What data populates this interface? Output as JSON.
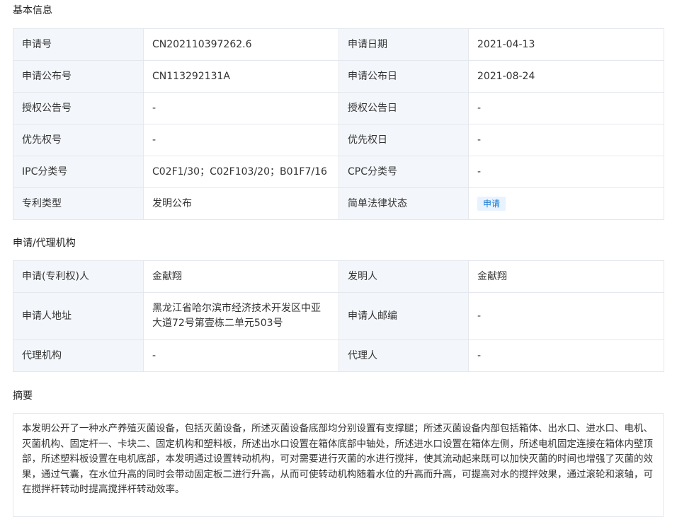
{
  "sections": {
    "basic": "基本信息",
    "agency": "申请/代理机构",
    "abstract": "摘要"
  },
  "basic_info": {
    "app_no_label": "申请号",
    "app_no": "CN202110397262.6",
    "app_date_label": "申请日期",
    "app_date": "2021-04-13",
    "pub_no_label": "申请公布号",
    "pub_no": "CN113292131A",
    "pub_date_label": "申请公布日",
    "pub_date": "2021-08-24",
    "grant_no_label": "授权公告号",
    "grant_no": "-",
    "grant_date_label": "授权公告日",
    "grant_date": "-",
    "priority_no_label": "优先权号",
    "priority_no": "-",
    "priority_date_label": "优先权日",
    "priority_date": "-",
    "ipc_label": "IPC分类号",
    "ipc": "C02F1/30；C02F103/20；B01F7/16",
    "cpc_label": "CPC分类号",
    "cpc": "-",
    "type_label": "专利类型",
    "type": "发明公布",
    "legal_status_label": "简单法律状态",
    "legal_status": "申请"
  },
  "agency_info": {
    "applicant_label": "申请(专利权)人",
    "applicant": "金献翔",
    "inventor_label": "发明人",
    "inventor": "金献翔",
    "address_label": "申请人地址",
    "address": "黑龙江省哈尔滨市经济技术开发区中亚大道72号第壹栋二单元503号",
    "postcode_label": "申请人邮编",
    "postcode": "-",
    "agency_label": "代理机构",
    "agency": "-",
    "agent_label": "代理人",
    "agent": "-"
  },
  "abstract_text": "本发明公开了一种水产养殖灭菌设备，包括灭菌设备，所述灭菌设备底部均分别设置有支撑腿；所述灭菌设备内部包括箱体、出水口、进水口、电机、灭菌机构、固定杆一、卡块二、固定机构和塑料板，所述出水口设置在箱体底部中轴处，所述进水口设置在箱体左侧，所述电机固定连接在箱体内壁顶部，所述塑料板设置在电机底部，本发明通过设置转动机构，可对需要进行灭菌的水进行搅拌，使其流动起来既可以加快灭菌的时间也增强了灭菌的效果，通过气囊，在水位升高的同时会带动固定板二进行升高，从而可使转动机构随着水位的升高而升高，可提高对水的搅拌效果，通过滚轮和滚轴，可在搅拌杆转动时提高搅拌杆转动效率。"
}
